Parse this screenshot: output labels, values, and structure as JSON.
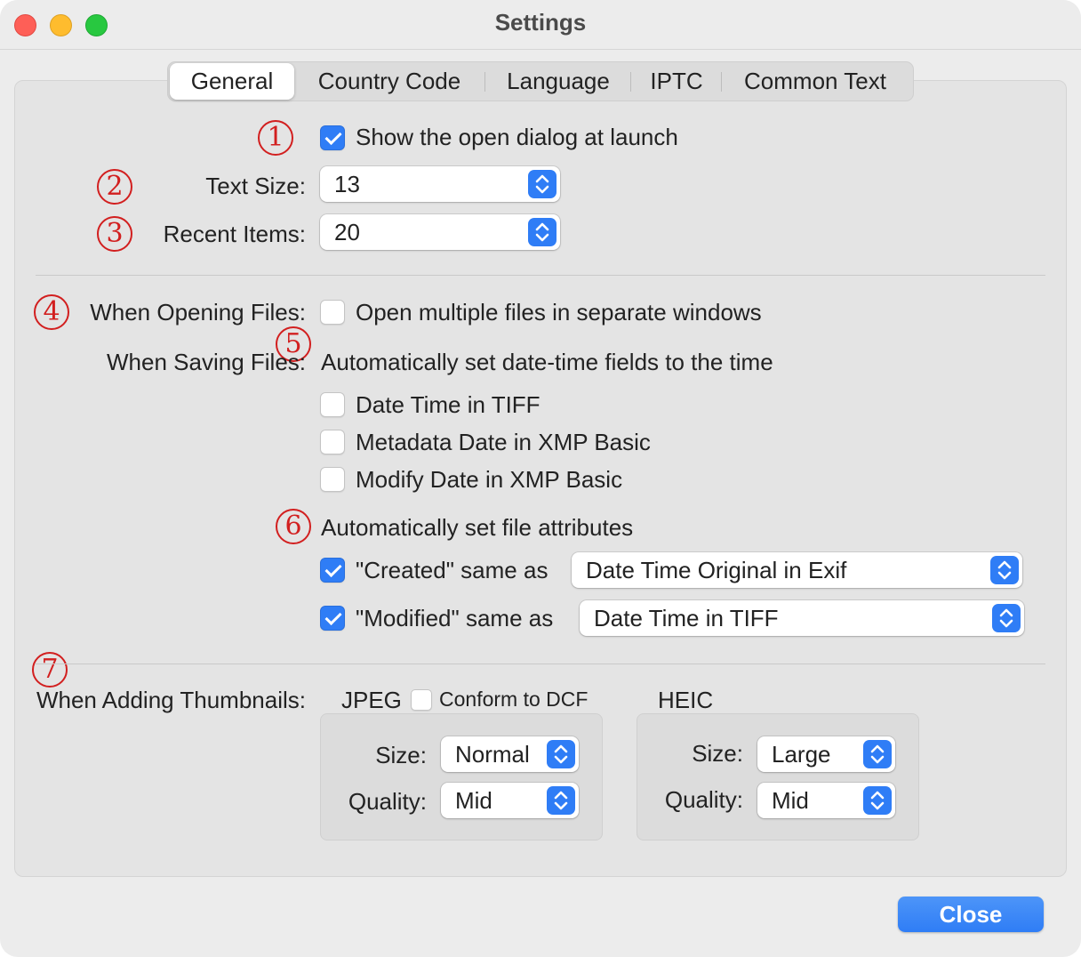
{
  "window": {
    "title": "Settings"
  },
  "tabs": [
    "General",
    "Country Code",
    "Language",
    "IPTC",
    "Common Text"
  ],
  "markers": [
    "1",
    "2",
    "3",
    "4",
    "5",
    "6",
    "7"
  ],
  "general": {
    "show_open_dialog": {
      "label": "Show the open dialog at launch",
      "checked": true
    },
    "text_size": {
      "label": "Text Size:",
      "value": "13"
    },
    "recent_items": {
      "label": "Recent Items:",
      "value": "20"
    },
    "opening": {
      "label": "When Opening Files:",
      "option": {
        "label": "Open multiple files in separate windows",
        "checked": false
      }
    },
    "saving": {
      "label": "When Saving Files:",
      "datetime_heading": "Automatically set date-time fields to the time",
      "datetime_options": [
        {
          "label": "Date Time in TIFF",
          "checked": false
        },
        {
          "label": "Metadata Date in XMP Basic",
          "checked": false
        },
        {
          "label": "Modify Date in XMP Basic",
          "checked": false
        }
      ],
      "attributes_heading": "Automatically set file attributes",
      "created": {
        "label": "\"Created\" same as",
        "checked": true,
        "value": "Date Time Original in Exif"
      },
      "modified": {
        "label": "\"Modified\" same as",
        "checked": true,
        "value": "Date Time in TIFF"
      }
    },
    "thumbnails": {
      "label": "When Adding Thumbnails:",
      "jpeg": {
        "title": "JPEG",
        "conform": {
          "label": "Conform to DCF",
          "checked": false
        },
        "size_label": "Size:",
        "size": "Normal",
        "quality_label": "Quality:",
        "quality": "Mid"
      },
      "heic": {
        "title": "HEIC",
        "size_label": "Size:",
        "size": "Large",
        "quality_label": "Quality:",
        "quality": "Mid"
      }
    }
  },
  "buttons": {
    "close": "Close"
  },
  "colors": {
    "accent": "#2f7df6",
    "marker": "#d21f1f"
  }
}
